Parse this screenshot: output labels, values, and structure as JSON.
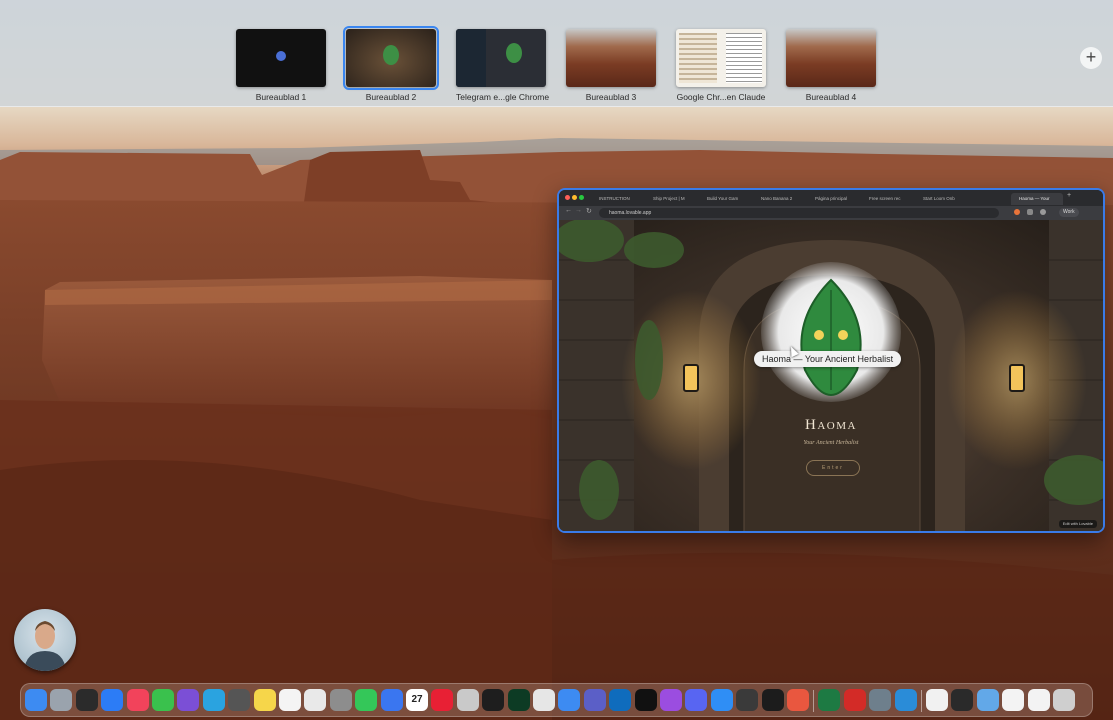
{
  "spaces": [
    {
      "label": "Bureaublad 1",
      "active": false
    },
    {
      "label": "Bureaublad 2",
      "active": true
    },
    {
      "label": "Telegram e...gle Chrome",
      "active": false
    },
    {
      "label": "Bureaublad 3",
      "active": false
    },
    {
      "label": "Google Chr...en Claude",
      "active": false
    },
    {
      "label": "Bureaublad 4",
      "active": false
    }
  ],
  "add_space_symbol": "+",
  "browser": {
    "tabs": [
      "INSTRUCTION",
      "Ship Project | M",
      "Build Your Gam",
      "Nano Banana 2",
      "Página principal",
      "Free screen rec",
      "Start Loom Onb",
      "Haoma — Your"
    ],
    "url": "haoma.lovable.app",
    "tooltip": "Haoma — Your Ancient Herbalist",
    "hero_title": "Haoma",
    "hero_subtitle": "Your Ancient Herbalist",
    "enter_label": "Enter",
    "edit_badge": "Edit with Lovable",
    "profile_label": "Work"
  },
  "dock": {
    "calendar_day": "27",
    "apps": [
      {
        "name": "finder",
        "color": "#3d8bf2"
      },
      {
        "name": "launchpad",
        "color": "#9aa3ad"
      },
      {
        "name": "activity-monitor",
        "color": "#2b2b2b"
      },
      {
        "name": "app-store",
        "color": "#2c7cf6"
      },
      {
        "name": "music",
        "color": "#f2435b"
      },
      {
        "name": "messages",
        "color": "#3ac14d"
      },
      {
        "name": "obsidian",
        "color": "#7b4fd6"
      },
      {
        "name": "telegram",
        "color": "#2aa3e0"
      },
      {
        "name": "calculator",
        "color": "#555555"
      },
      {
        "name": "notes",
        "color": "#f6d64a"
      },
      {
        "name": "reminders",
        "color": "#f4f4f4"
      },
      {
        "name": "chrome",
        "color": "#e9e9e9"
      },
      {
        "name": "system-settings",
        "color": "#8d8d8d"
      },
      {
        "name": "whatsapp",
        "color": "#34c759"
      },
      {
        "name": "signal",
        "color": "#3a76f0"
      },
      {
        "name": "calendar",
        "color": "#ffffff"
      },
      {
        "name": "opera",
        "color": "#e82034"
      },
      {
        "name": "affinity",
        "color": "#c9c9c9"
      },
      {
        "name": "stocks",
        "color": "#1e1e1e"
      },
      {
        "name": "robinhood",
        "color": "#0d3b24"
      },
      {
        "name": "preview",
        "color": "#e6e6e6"
      },
      {
        "name": "mail",
        "color": "#3d8bf2"
      },
      {
        "name": "teams",
        "color": "#5b5fc7"
      },
      {
        "name": "outlook",
        "color": "#0f6cbd"
      },
      {
        "name": "capcut",
        "color": "#111111"
      },
      {
        "name": "podcasts",
        "color": "#9b4de0"
      },
      {
        "name": "discord",
        "color": "#5865f2"
      },
      {
        "name": "safari",
        "color": "#2f8ef5"
      },
      {
        "name": "davinci",
        "color": "#3a3a3a"
      },
      {
        "name": "terminal",
        "color": "#1c1c1c"
      },
      {
        "name": "claude",
        "color": "#e9573f"
      },
      {
        "name": "excel",
        "color": "#1d7a43"
      },
      {
        "name": "acrobat",
        "color": "#d32b27"
      },
      {
        "name": "disk-utility",
        "color": "#6e7f8c"
      },
      {
        "name": "quicktime",
        "color": "#2a8cd8"
      },
      {
        "name": "document",
        "color": "#f1f1f1"
      },
      {
        "name": "screenshot-file",
        "color": "#2a2a2a"
      },
      {
        "name": "folder",
        "color": "#62a8e8"
      },
      {
        "name": "folder-white",
        "color": "#f3f3f3"
      },
      {
        "name": "folder-white-2",
        "color": "#f3f3f3"
      },
      {
        "name": "trash",
        "color": "#cfcfcf"
      }
    ]
  }
}
